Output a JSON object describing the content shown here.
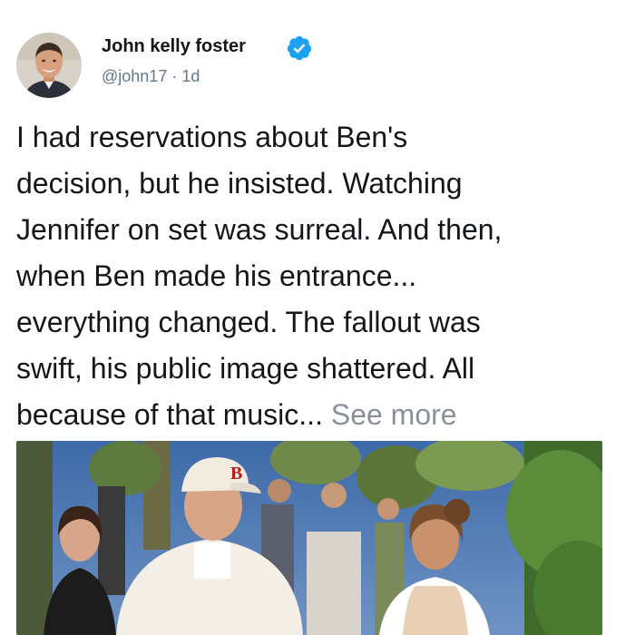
{
  "author": {
    "name": "John kelly foster",
    "handle": "@john17",
    "separator": "·",
    "time": "1d",
    "verified": true,
    "avatar_icon": "profile-photo-man"
  },
  "tweet": {
    "lines": [
      "I had reservations about Ben's",
      "decision, but he insisted. Watching",
      "Jennifer on set was surreal. And then,",
      "when Ben made his entrance...",
      "everything changed. The fallout was",
      "swift, his public image shattered. All",
      "because of that music... "
    ],
    "see_more": "See more"
  },
  "media": {
    "description_icon": "photo-thumbnail",
    "cap_letter": "B"
  },
  "colors": {
    "text": "#14171a",
    "secondary": "#657786",
    "link_muted": "#8a9198",
    "verified_blue": "#1da1f2"
  }
}
